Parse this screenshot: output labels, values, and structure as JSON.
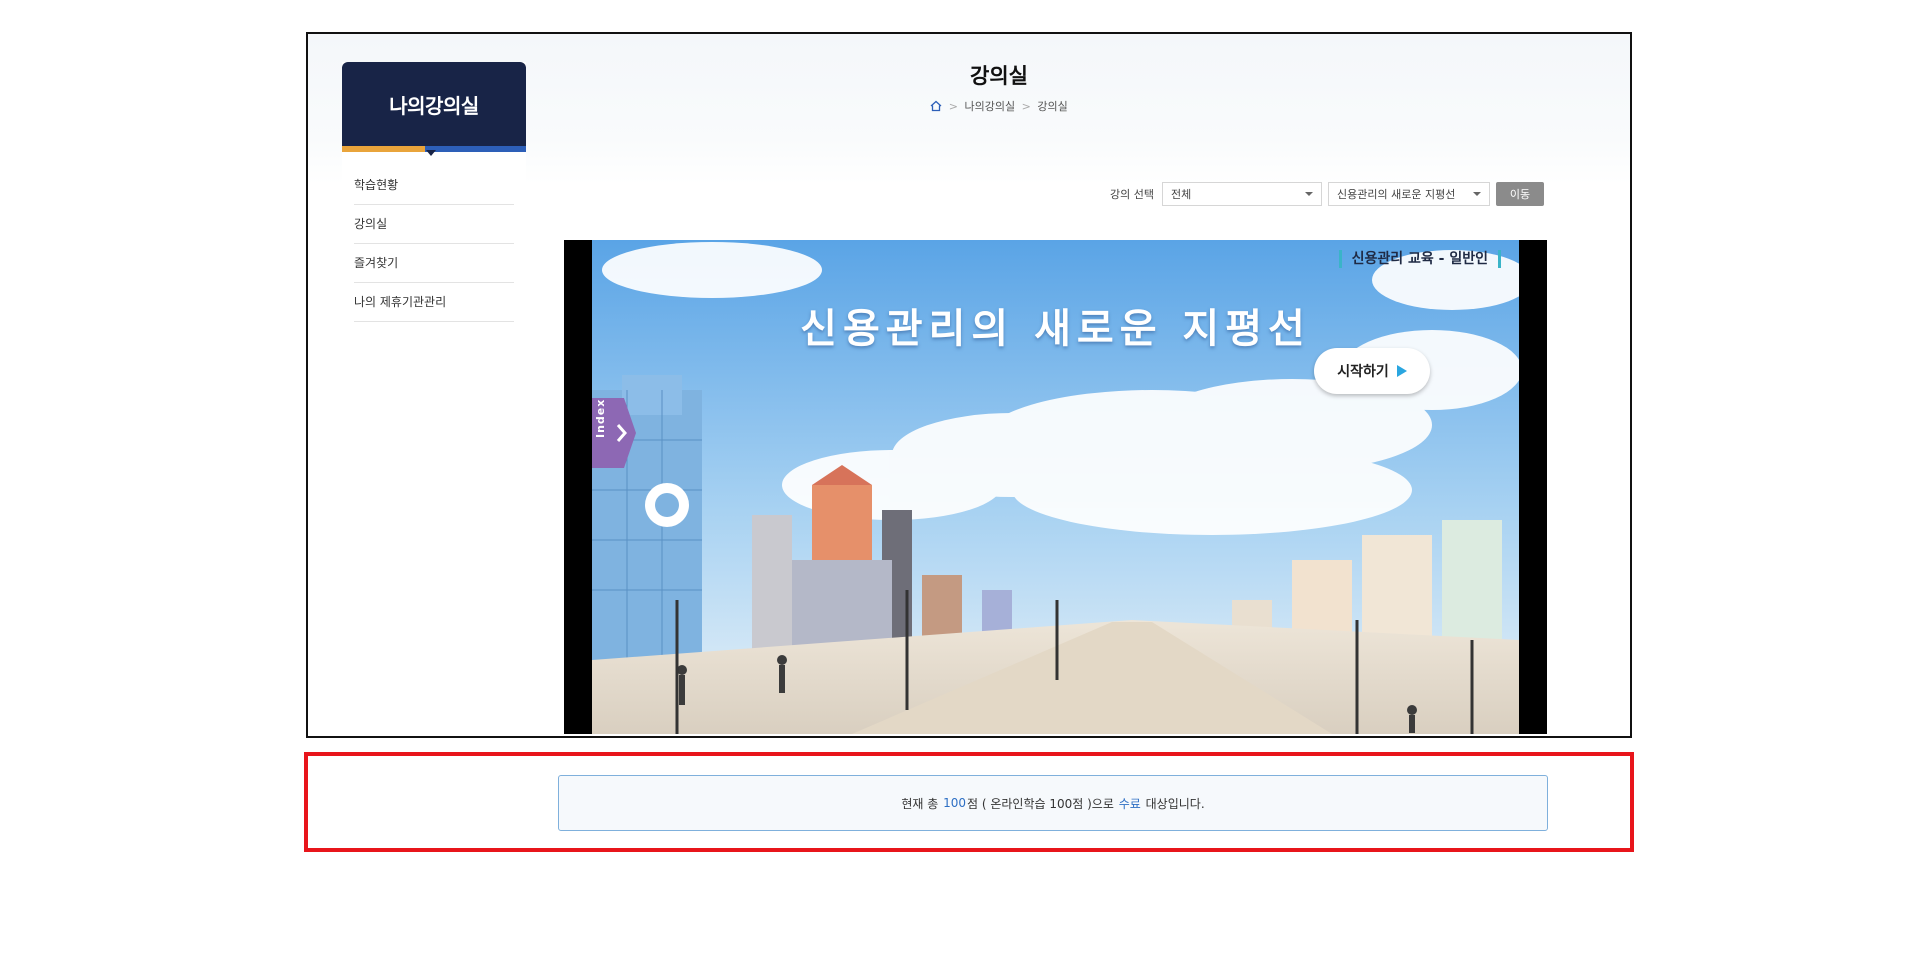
{
  "sidebar": {
    "title": "나의강의실",
    "items": [
      {
        "label": "학습현황"
      },
      {
        "label": "강의실"
      },
      {
        "label": "즐겨찾기"
      },
      {
        "label": "나의 제휴기관관리"
      }
    ]
  },
  "header": {
    "title": "강의실",
    "breadcrumb": [
      "나의강의실",
      "강의실"
    ]
  },
  "lecture_select": {
    "label": "강의 선택",
    "category_value": "전체",
    "course_value": "신용관리의 새로운 지평선",
    "go_label": "이동"
  },
  "player": {
    "course_tag": "신용관리 교육 - 일반인",
    "lesson_title": "신용관리의 새로운 지평선",
    "start_label": "시작하기",
    "index_label": "Index"
  },
  "score_notice": {
    "prefix": "현재 총",
    "total": "100",
    "unit": "점 ( 온라인학습 100점 )으로",
    "status": "수료",
    "suffix": "대상입니다."
  },
  "colors": {
    "sidebar_header": "#182447",
    "accent_orange": "#e9a43b",
    "accent_blue": "#2d5fb8",
    "highlight_text": "#2d6fc4",
    "annotation_red": "#e8151b"
  }
}
